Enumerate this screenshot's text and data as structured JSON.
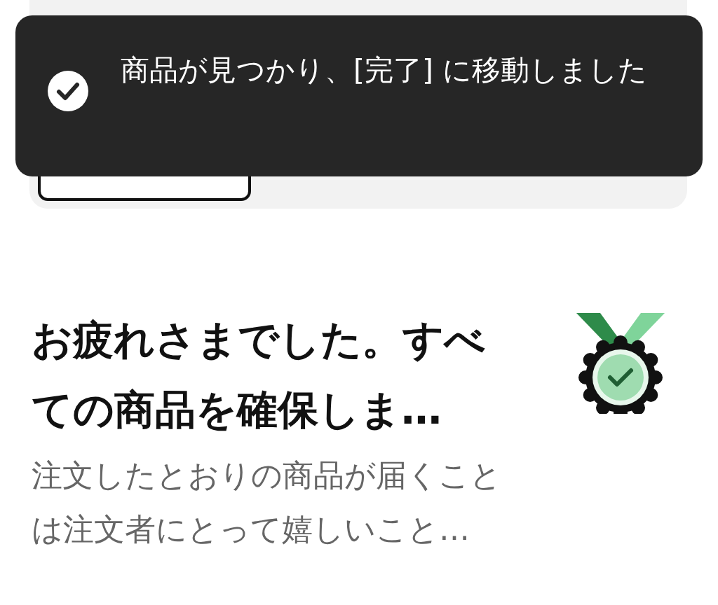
{
  "toast": {
    "message": "商品が見つかり、[完了] に移動しました"
  },
  "completion": {
    "heading": "お疲れさまでした。すべての商品を確保しま…",
    "description": "注文したとおりの商品が届くことは注文者にとって嬉しいこと…"
  }
}
